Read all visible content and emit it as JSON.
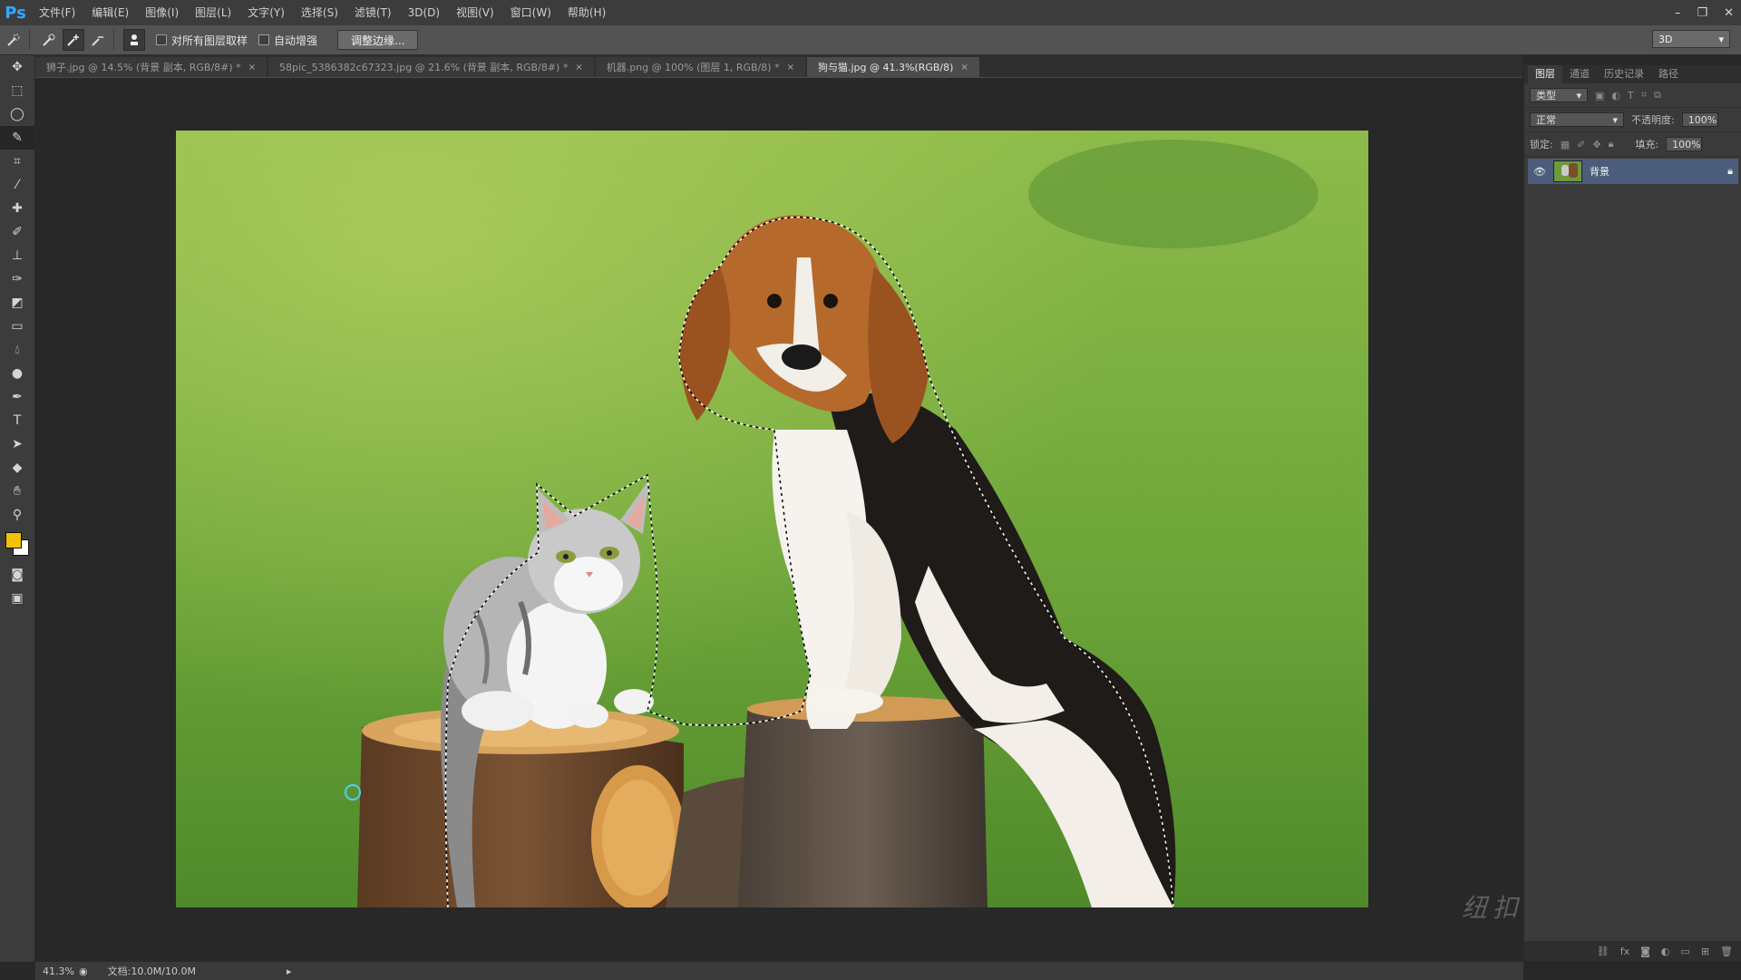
{
  "app": {
    "logo": "Ps"
  },
  "menu": [
    "文件(F)",
    "编辑(E)",
    "图像(I)",
    "图层(L)",
    "文字(Y)",
    "选择(S)",
    "滤镜(T)",
    "3D(D)",
    "视图(V)",
    "窗口(W)",
    "帮助(H)"
  ],
  "window_buttons": {
    "minimize": "–",
    "restore": "❐",
    "close": "✕"
  },
  "options": {
    "sample_all_label": "对所有图层取样",
    "auto_enhance_label": "自动增强",
    "refine_button": "调整边缘...",
    "workspace": "3D"
  },
  "tabs": [
    {
      "label": "狮子.jpg @ 14.5% (背景 副本, RGB/8#) *",
      "close": "×"
    },
    {
      "label": "58pic_5386382c67323.jpg @ 21.6% (背景 副本, RGB/8#) *",
      "close": "×"
    },
    {
      "label": "机器.png @ 100% (图层 1, RGB/8) *",
      "close": "×"
    },
    {
      "label": "狗与猫.jpg @ 41.3%(RGB/8)",
      "close": "×"
    }
  ],
  "panel": {
    "tabs": [
      "图层",
      "通道",
      "历史记录",
      "路径"
    ],
    "kind_filter": "类型",
    "blend_mode": "正常",
    "opacity_label": "不透明度:",
    "opacity_value": "100%",
    "lock_label": "锁定:",
    "fill_label": "填充:",
    "fill_value": "100%",
    "layer_name": "背景"
  },
  "status": {
    "zoom": "41.3%",
    "doc_info": "文档:10.0M/10.0M"
  },
  "watermark": "纽扣摄影后期教程",
  "colors": {
    "foreground": "#f2c200",
    "background": "#ffffff",
    "selected_layer": "#4b5d7a"
  }
}
